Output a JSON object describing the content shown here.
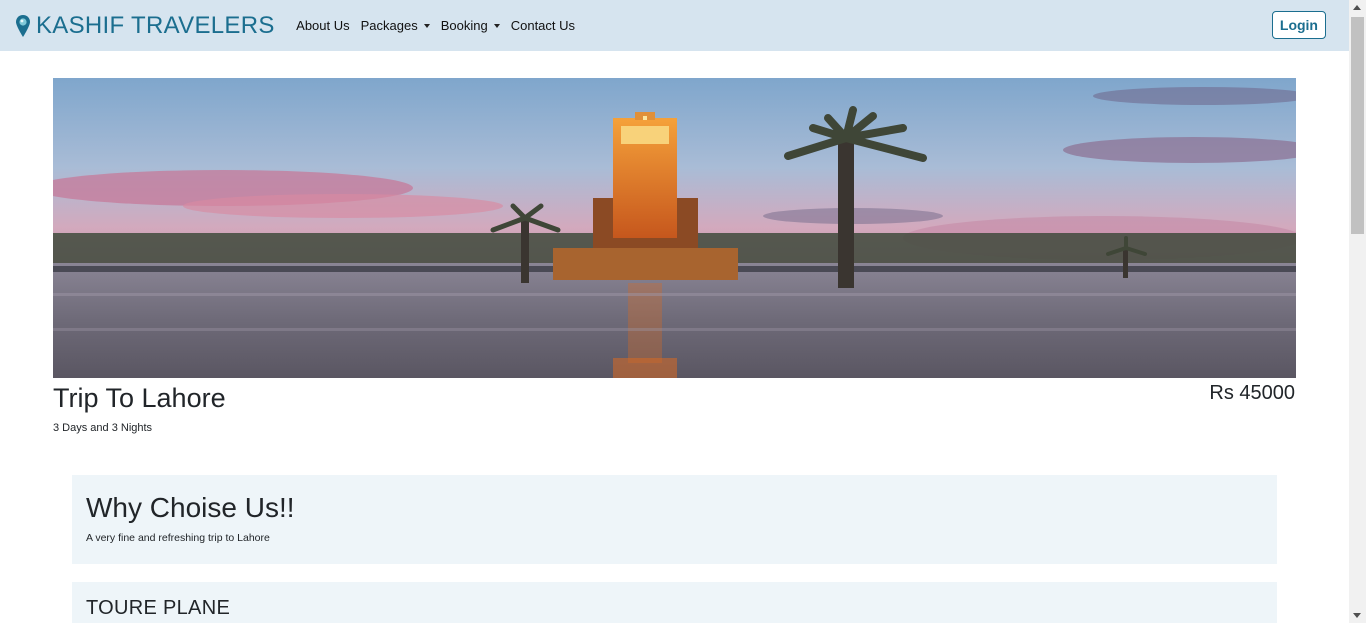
{
  "navbar": {
    "brand": "KASHIF TRAVELERS",
    "brand_icon": "map-pin-icon",
    "links": [
      {
        "label": "About Us",
        "dropdown": false
      },
      {
        "label": "Packages",
        "dropdown": true
      },
      {
        "label": "Booking",
        "dropdown": true
      },
      {
        "label": "Contact Us",
        "dropdown": false
      }
    ],
    "login_label": "Login"
  },
  "hero": {
    "image": "clock-tower-plaza-sunset-photo"
  },
  "trip": {
    "title": "Trip To Lahore",
    "duration": "3 Days and 3 Nights",
    "price": "Rs 45000"
  },
  "why": {
    "heading": "Why Choise Us!!",
    "text": "A very fine and refreshing trip to Lahore"
  },
  "tour": {
    "heading": "TOURE PLANE"
  },
  "colors": {
    "navbar_bg": "#d6e4ef",
    "brand": "#1b6e8f",
    "card_bg": "#eef5f9"
  }
}
